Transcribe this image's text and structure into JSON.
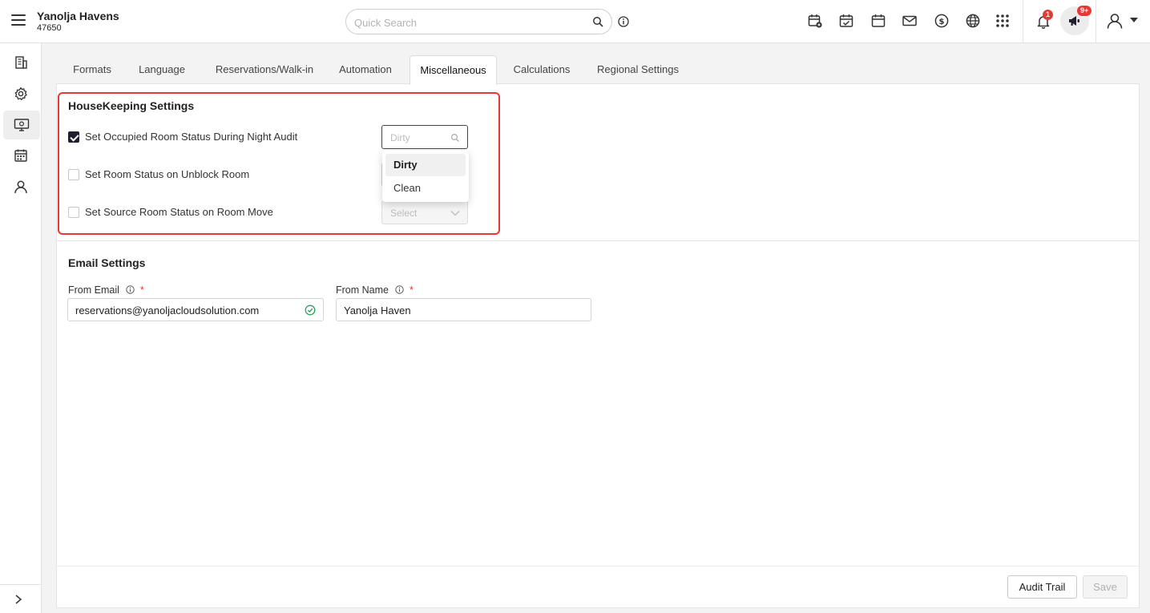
{
  "header": {
    "property_name": "Yanolja Havens",
    "property_id": "47650",
    "search_placeholder": "Quick Search",
    "notification_count": "1",
    "announcement_count": "9+"
  },
  "tabs": [
    {
      "label": "Formats"
    },
    {
      "label": "Language"
    },
    {
      "label": "Reservations/Walk-in"
    },
    {
      "label": "Automation"
    },
    {
      "label": "Miscellaneous",
      "active": true
    },
    {
      "label": "Calculations"
    },
    {
      "label": "Regional Settings"
    }
  ],
  "housekeeping": {
    "title": "HouseKeeping Settings",
    "settings": [
      {
        "label": "Set Occupied Room Status During Night Audit",
        "checked": true,
        "select_value": "Dirty"
      },
      {
        "label": "Set Room Status on Unblock Room",
        "checked": false,
        "select_value": ""
      },
      {
        "label": "Set Source Room Status on Room Move",
        "checked": false,
        "select_value": "Select"
      }
    ],
    "dropdown_options": [
      "Dirty",
      "Clean"
    ]
  },
  "email": {
    "title": "Email Settings",
    "from_email_label": "From Email",
    "from_email_value": "reservations@yanoljacloudsolution.com",
    "from_name_label": "From Name",
    "from_name_value": "Yanolja Haven",
    "required_mark": "*"
  },
  "footer": {
    "audit_trail_label": "Audit Trail",
    "save_label": "Save"
  },
  "colors": {
    "highlight_border": "#e53935",
    "badge": "#e53935",
    "checkbox_checked": "#1f1f2e",
    "valid_green": "#2e9e5b"
  }
}
